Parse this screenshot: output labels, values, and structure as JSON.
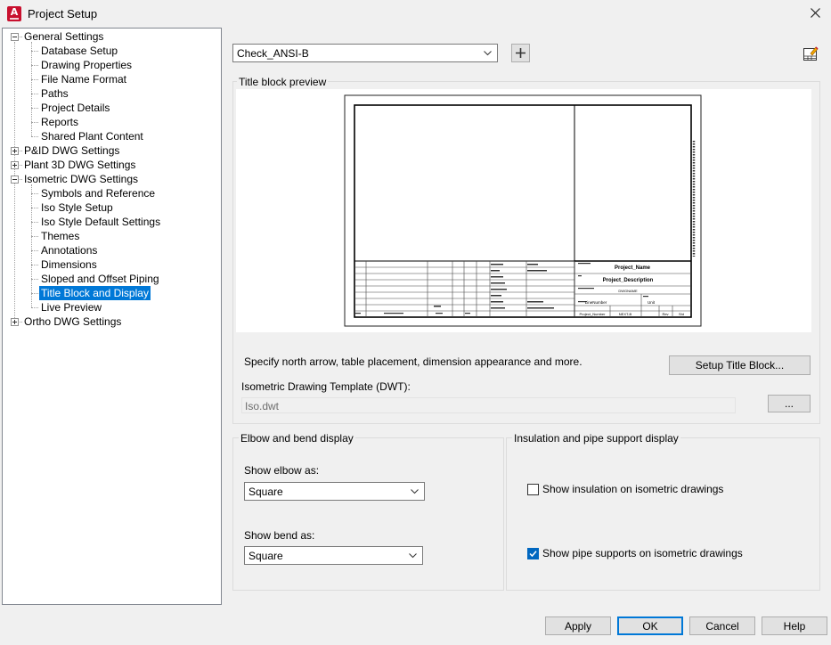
{
  "window": {
    "title": "Project Setup",
    "app_icon_letter": "A"
  },
  "tree": [
    {
      "label": "General Settings",
      "level": 0,
      "expander": "minus"
    },
    {
      "label": "Database Setup",
      "level": 1
    },
    {
      "label": "Drawing Properties",
      "level": 1
    },
    {
      "label": "File Name Format",
      "level": 1
    },
    {
      "label": "Paths",
      "level": 1
    },
    {
      "label": "Project Details",
      "level": 1
    },
    {
      "label": "Reports",
      "level": 1
    },
    {
      "label": "Shared Plant Content",
      "level": 1
    },
    {
      "label": "P&ID DWG Settings",
      "level": 0,
      "expander": "plus"
    },
    {
      "label": "Plant 3D DWG Settings",
      "level": 0,
      "expander": "plus"
    },
    {
      "label": "Isometric DWG Settings",
      "level": 0,
      "expander": "minus"
    },
    {
      "label": "Symbols and Reference",
      "level": 1
    },
    {
      "label": "Iso Style Setup",
      "level": 1
    },
    {
      "label": "Iso Style Default Settings",
      "level": 1
    },
    {
      "label": "Themes",
      "level": 1
    },
    {
      "label": "Annotations",
      "level": 1
    },
    {
      "label": "Dimensions",
      "level": 1
    },
    {
      "label": "Sloped and Offset Piping",
      "level": 1
    },
    {
      "label": "Title Block and Display",
      "level": 1,
      "selected": true
    },
    {
      "label": "Live Preview",
      "level": 1
    },
    {
      "label": "Ortho DWG Settings",
      "level": 0,
      "expander": "plus"
    }
  ],
  "style_select": {
    "value": "Check_ANSI-B"
  },
  "preview_group": {
    "title": "Title block preview",
    "tb": {
      "project_name": "Project_Name",
      "project_description": "Project_Description",
      "dwg_label": "DWGNAME",
      "line_number": "LineNumber",
      "project_number": "Project_Number",
      "size_val": "NEXT-B",
      "unit_label": "Unit",
      "rev_val": "Rev",
      "sheet_val": "Sht"
    },
    "description": "Specify north arrow, table placement, dimension appearance and more.",
    "setup_button": "Setup Title Block...",
    "template_label": "Isometric Drawing Template (DWT):",
    "template_value": "Iso.dwt",
    "browse_button": "..."
  },
  "elbow_group": {
    "title": "Elbow and bend display",
    "elbow_label": "Show elbow as:",
    "elbow_value": "Square",
    "bend_label": "Show bend as:",
    "bend_value": "Square"
  },
  "insulation_group": {
    "title": "Insulation and pipe support display",
    "insulation_label": "Show insulation on isometric drawings",
    "insulation_checked": false,
    "supports_label": "Show pipe supports on isometric drawings",
    "supports_checked": true
  },
  "footer": {
    "apply": "Apply",
    "ok": "OK",
    "cancel": "Cancel",
    "help": "Help"
  },
  "colors": {
    "selection": "#0078d7",
    "brand": "#c8102e",
    "checkbox": "#0067c0"
  }
}
